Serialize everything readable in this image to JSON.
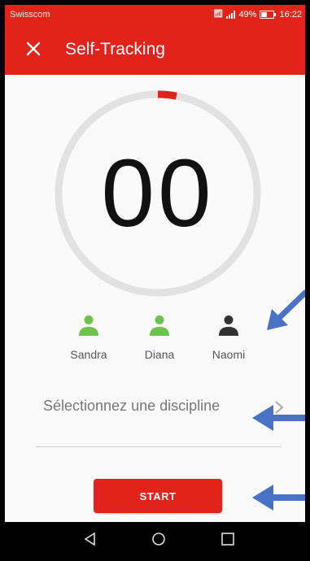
{
  "status_bar": {
    "carrier": "Swisscom",
    "battery": "49%",
    "time": "16:22"
  },
  "app_bar": {
    "title": "Self-Tracking",
    "close_icon": "close-icon"
  },
  "timer": {
    "value": "00",
    "progress_fraction": 0.03,
    "ring_color": "#e2e2e2",
    "progress_color": "#e2231a"
  },
  "participants": [
    {
      "name": "Sandra",
      "icon": "person-icon",
      "color": "#6cc24a"
    },
    {
      "name": "Diana",
      "icon": "person-icon",
      "color": "#6cc24a"
    },
    {
      "name": "Naomi",
      "icon": "person-icon",
      "color": "#333333"
    }
  ],
  "discipline": {
    "placeholder": "Sélectionnez une discipline"
  },
  "actions": {
    "start_label": "START"
  },
  "nav": {
    "back_icon": "back-icon",
    "home_icon": "home-icon",
    "recents_icon": "recents-icon"
  },
  "colors": {
    "brand_red": "#e2231a",
    "annotation_arrow": "#4a72c4"
  }
}
